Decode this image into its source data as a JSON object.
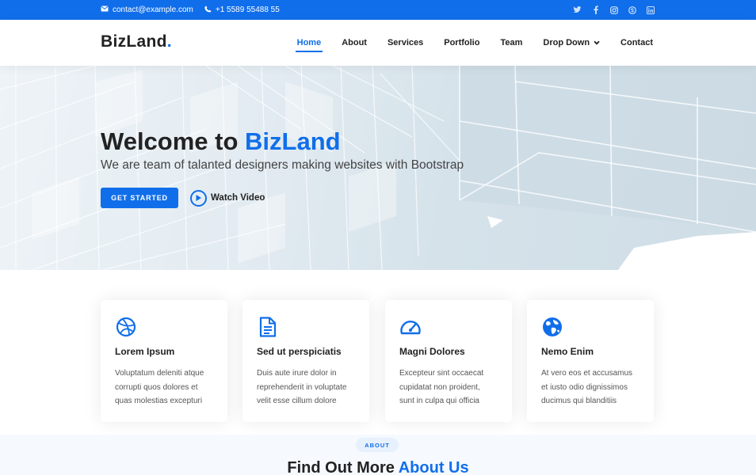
{
  "topbar": {
    "email": "contact@example.com",
    "phone": "+1 5589 55488 55",
    "socials": [
      "twitter-icon",
      "facebook-icon",
      "instagram-icon",
      "skype-icon",
      "linkedin-icon"
    ]
  },
  "header": {
    "logo": "BizLand",
    "logo_dot": ".",
    "nav": [
      {
        "label": "Home",
        "active": true
      },
      {
        "label": "About"
      },
      {
        "label": "Services"
      },
      {
        "label": "Portfolio"
      },
      {
        "label": "Team"
      },
      {
        "label": "Drop Down",
        "has_dropdown": true
      },
      {
        "label": "Contact"
      }
    ]
  },
  "hero": {
    "title_prefix": "Welcome to ",
    "title_accent": "BizLand",
    "subtitle": "We are team of talanted designers making websites with Bootstrap",
    "cta_label": "GET STARTED",
    "video_label": "Watch Video"
  },
  "services": [
    {
      "icon": "dribbble-icon",
      "title": "Lorem Ipsum",
      "lines": [
        "Voluptatum deleniti atque",
        "corrupti quos dolores et",
        "quas molestias excepturi"
      ]
    },
    {
      "icon": "document-icon",
      "title": "Sed ut perspiciatis",
      "lines": [
        "Duis aute irure dolor in",
        "reprehenderit in voluptate",
        "velit esse cillum dolore"
      ]
    },
    {
      "icon": "speedometer-icon",
      "title": "Magni Dolores",
      "lines": [
        "Excepteur sint occaecat",
        "cupidatat non proident,",
        "sunt in culpa qui officia"
      ]
    },
    {
      "icon": "globe-icon",
      "title": "Nemo Enim",
      "lines": [
        "At vero eos et accusamus",
        "et iusto odio dignissimos",
        "ducimus qui blanditiis"
      ]
    }
  ],
  "about": {
    "badge": "ABOUT",
    "title_prefix": "Find Out More ",
    "title_accent": "About Us"
  },
  "colors": {
    "accent": "#106eea",
    "text": "#222222"
  }
}
